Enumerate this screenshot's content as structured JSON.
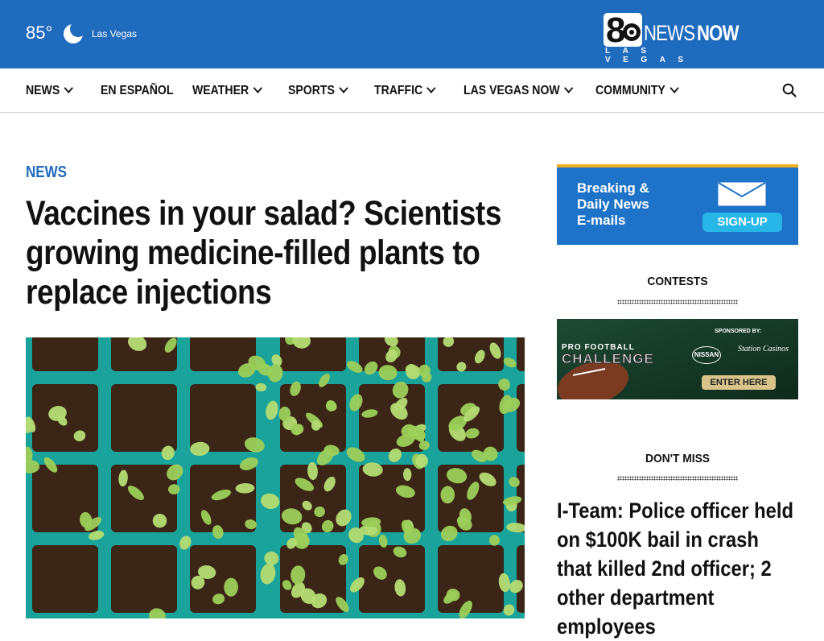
{
  "header": {
    "temperature": "85°",
    "weather_icon": "moon-icon",
    "city": "Las Vegas",
    "logo": {
      "number": "8",
      "brand_part1": "NEWS",
      "brand_part2": "NOW",
      "subtitle": "LAS VEGAS"
    }
  },
  "nav": {
    "items": [
      {
        "label": "NEWS",
        "has_dropdown": true
      },
      {
        "label": "EN ESPAÑOL",
        "has_dropdown": false
      },
      {
        "label": "WEATHER",
        "has_dropdown": true
      },
      {
        "label": "SPORTS",
        "has_dropdown": true
      },
      {
        "label": "TRAFFIC",
        "has_dropdown": true
      },
      {
        "label": "LAS VEGAS NOW",
        "has_dropdown": true
      },
      {
        "label": "COMMUNITY",
        "has_dropdown": true
      }
    ],
    "search_icon": "search-icon"
  },
  "article": {
    "category": "NEWS",
    "headline": "Vaccines in your salad? Scientists growing medicine-filled plants to replace injections",
    "image_description_icon": "seedling-trays-photo"
  },
  "sidebar": {
    "newsletter": {
      "line1": "Breaking &",
      "line2": "Daily News",
      "line3": "E-mails",
      "button": "SIGN-UP",
      "icon": "envelope-icon"
    },
    "contests_title": "CONTESTS",
    "contest_banner": {
      "line1": "PRO FOOTBALL",
      "line2": "CHALLENGE",
      "sponsored_by": "SPONSORED BY:",
      "sponsor1": "NISSAN",
      "sponsor2": "Station Casinos",
      "button": "ENTER HERE"
    },
    "dont_miss_title": "DON'T MISS",
    "dont_miss_headline": "I-Team: Police officer held on $100K bail in crash that killed 2nd officer; 2 other department employees"
  },
  "colors": {
    "brand_blue": "#1f6bbd",
    "promo_blue": "#1e73c8",
    "promo_accent": "#f0b020",
    "signup_button": "#26b6e8",
    "contest_green": "#17402a"
  }
}
